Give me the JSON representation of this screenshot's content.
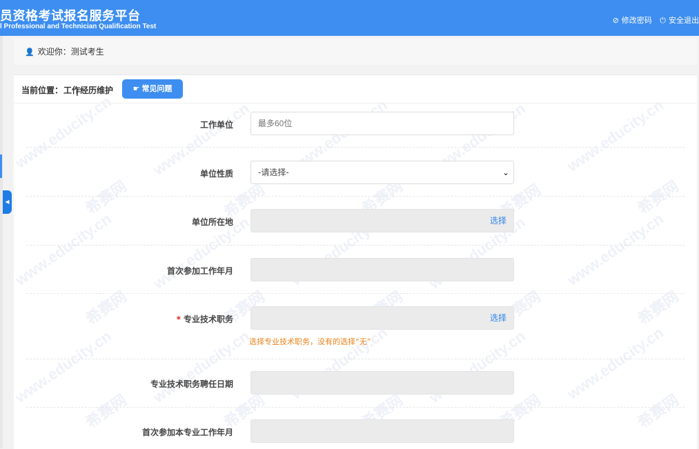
{
  "header": {
    "title": "员资格考试报名服务平台",
    "subtitle": "l Professional and Technician Qualification Test",
    "links": [
      {
        "icon": "edit-icon",
        "label": "修改密码"
      },
      {
        "icon": "power-icon",
        "label": "安全退出"
      }
    ]
  },
  "welcome": {
    "text": "欢迎你：测试考生"
  },
  "breadcrumb": {
    "label": "当前位置：",
    "page": "工作经历维护",
    "faq_button": "常见问题"
  },
  "form": {
    "fields": [
      {
        "label": "工作单位",
        "type": "text",
        "placeholder": "最多60位",
        "required": false
      },
      {
        "label": "单位性质",
        "type": "select",
        "value": "-请选择-",
        "required": false
      },
      {
        "label": "单位所在地",
        "type": "picker",
        "action": "选择",
        "required": false
      },
      {
        "label": "首次参加工作年月",
        "type": "disabled",
        "required": false
      },
      {
        "label": "专业技术职务",
        "type": "picker",
        "action": "选择",
        "required": true,
        "hint": "选择专业技术职务，没有的选择“无”"
      },
      {
        "label": "专业技术职务聘任日期",
        "type": "disabled",
        "required": false
      },
      {
        "label": "首次参加本专业工作年月",
        "type": "disabled",
        "required": false
      }
    ],
    "required_mark": "*"
  },
  "watermarks": [
    "www.educity.cn",
    "希赛网",
    "希赛"
  ],
  "colors": {
    "primary": "#3d8ef0",
    "required": "#e0261b",
    "hint": "#e9821a",
    "link": "#2f83e8"
  }
}
